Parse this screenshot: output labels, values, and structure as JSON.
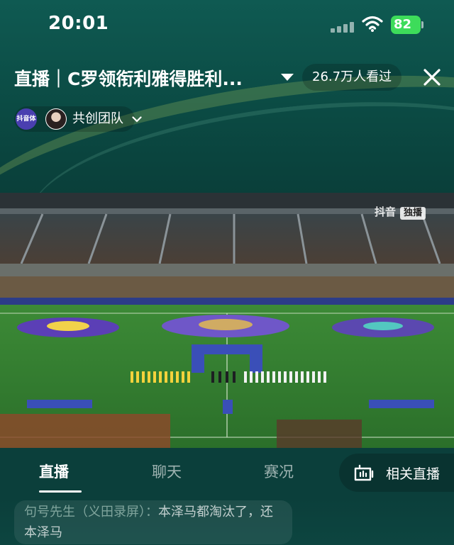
{
  "status_bar": {
    "time": "20:01",
    "battery": "82"
  },
  "header": {
    "title": "直播｜C罗领衔利雅得胜利...",
    "viewers": "26.7万人看过",
    "team_label": "共创团队",
    "team_logo_text": "抖音体"
  },
  "video": {
    "watermark": "抖音",
    "watermark_tag": "独播"
  },
  "tabs": [
    {
      "label": "直播",
      "active": true
    },
    {
      "label": "聊天",
      "active": false
    },
    {
      "label": "赛况",
      "active": false
    }
  ],
  "related_live": {
    "label": "相关直播"
  },
  "chat": {
    "user": "句号先生（义田录屏）：",
    "message": "本泽马都淘汰了，还本泽马"
  },
  "colors": {
    "header_bg": "#0f5a52",
    "battery": "#3ddc5a",
    "pitch": "#2f7a2e"
  }
}
